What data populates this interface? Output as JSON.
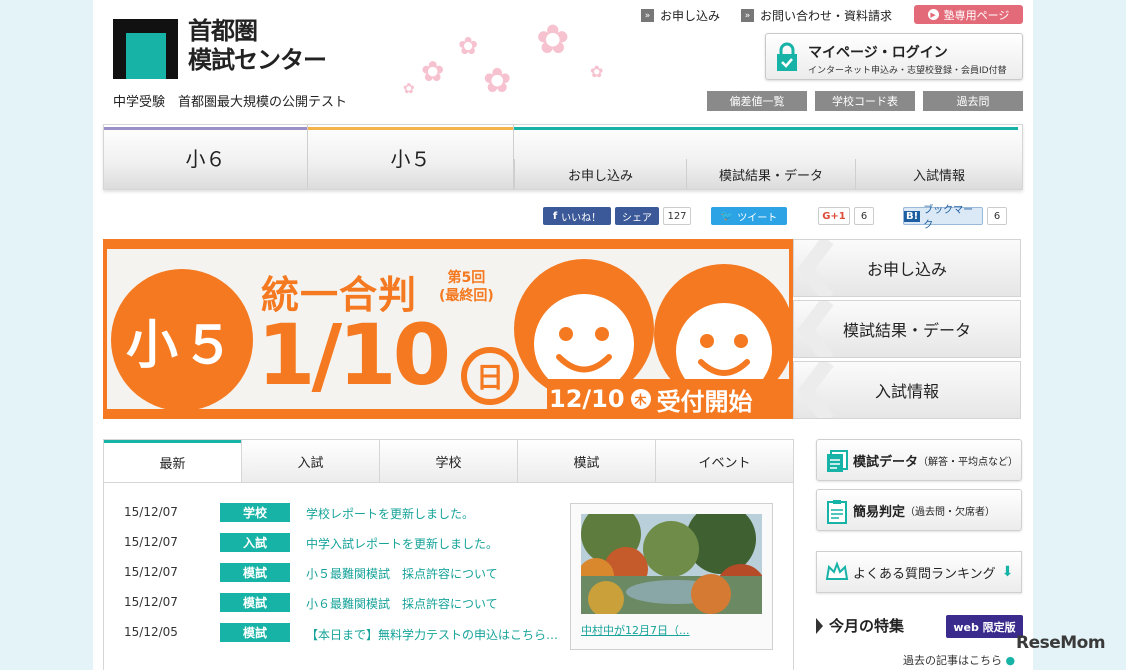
{
  "header": {
    "logo_line1": "首都圏",
    "logo_line2": "模試センター",
    "tagline": "中学受験　首都圏最大規模の公開テスト",
    "top_links": [
      "お申し込み",
      "お問い合わせ・資料請求"
    ],
    "juku_label": "塾専用ページ",
    "login_title": "マイページ・ログイン",
    "login_sub": "インターネット申込み・志望校登録・会員ID付替",
    "gray_buttons": [
      "偏差値一覧",
      "学校コード表",
      "過去問"
    ]
  },
  "nav": {
    "grades": [
      "小６",
      "小５"
    ],
    "grade_colors": [
      "#9b8fc8",
      "#f3b34a"
    ],
    "sub_links": [
      "お申し込み",
      "模試結果・データ",
      "入試情報"
    ]
  },
  "social": {
    "like": "いいね！",
    "share": "シェア",
    "share_count": "127",
    "tweet": "ツイート",
    "gplus": "G+1",
    "gplus_count": "6",
    "bookmark": "ブックマーク",
    "bookmark_count": "6"
  },
  "banner": {
    "grade": "小５",
    "title": "統一合判",
    "round_line1": "第5回",
    "round_line2": "(最終回)",
    "date": "1/10",
    "day": "日",
    "reg_date": "12/10",
    "reg_weekday": "木",
    "reg_text": "受付開始",
    "accent": "#f47920"
  },
  "side_buttons": [
    "お申し込み",
    "模試結果・データ",
    "入試情報"
  ],
  "tabs": [
    "最新",
    "入試",
    "学校",
    "模試",
    "イベント"
  ],
  "news": [
    {
      "date": "15/12/07",
      "badge": "学校",
      "title": "学校レポートを更新しました。"
    },
    {
      "date": "15/12/07",
      "badge": "入試",
      "title": "中学入試レポートを更新しました。"
    },
    {
      "date": "15/12/07",
      "badge": "模試",
      "title": "小５最難関模試　採点許容について"
    },
    {
      "date": "15/12/07",
      "badge": "模試",
      "title": "小６最難関模試　採点許容について"
    },
    {
      "date": "15/12/05",
      "badge": "模試",
      "title": "【本日まで】無料学力テストの申込はこちら…"
    }
  ],
  "photo_caption": "中村中が12月7日（...",
  "right_buttons": [
    {
      "bold": "模試データ",
      "small": "（解答・平均点など）"
    },
    {
      "bold": "簡易判定",
      "small": "（過去問・欠席者）"
    },
    {
      "bold": "",
      "small": "よくある質問ランキング"
    }
  ],
  "feature_title": "今月の特集",
  "web_badge": "web 限定版",
  "past_articles": "過去の記事はこちら",
  "watermark": "ReseMom"
}
